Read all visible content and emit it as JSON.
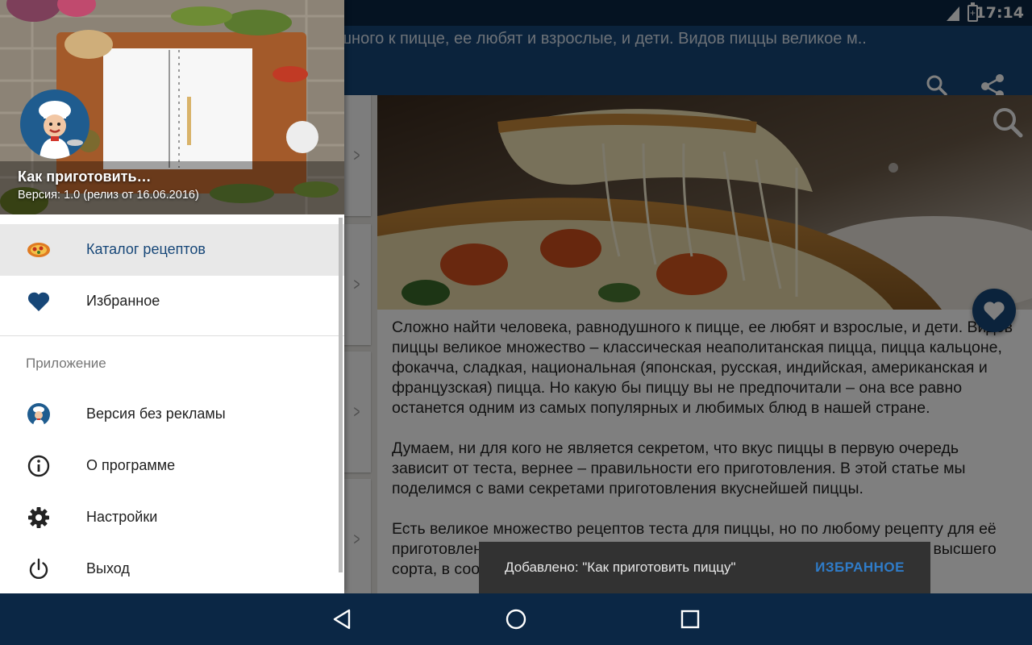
{
  "status_bar": {
    "time": "17:14",
    "battery_glyph": "+"
  },
  "toolbar": {
    "title": "…шного к пицце, ее любят и взрослые, и дети. Видов пиццы великое м..",
    "search_icon": "search-icon",
    "share_icon": "share-icon"
  },
  "article": {
    "paragraphs": [
      "Сложно найти человека, равнодушного к пицце, ее любят и взрослые, и дети. Видов пиццы великое множество – классическая неаполитанская пицца, пицца кальцоне, фокачча, сладкая, национальная (японская, русская, индийская, американская и французская) пицца. Но какую бы пиццу вы не предпочитали – она все равно останется одним из самых популярных и любимых блюд в нашей стране.",
      "Думаем, ни для кого не является секретом, что вкус пиццы в первую очередь зависит от теста, вернее – правильности его приготовления. В этой статье мы поделимся с вами секретами приготовления вкуснейшей пиццы.",
      "Есть великое множество рецептов теста для пиццы, но по любому рецепту для её приготовления используют в основном два вида муки – хлебопекарную и высшего сорта, в соотношении"
    ]
  },
  "snackbar": {
    "message": "Добавлено: \"Как приготовить пиццу\"",
    "action": "ИЗБРАННОЕ"
  },
  "drawer": {
    "app_name": "Как приготовить…",
    "version": "Версия: 1.0 (релиз от 16.06.2016)",
    "menu": [
      {
        "label": "Каталог рецептов",
        "icon": "pizza-icon",
        "active": true
      },
      {
        "label": "Избранное",
        "icon": "heart-icon",
        "active": false
      }
    ],
    "section_title": "Приложение",
    "app_menu": [
      {
        "label": "Версия без рекламы",
        "icon": "chef-icon"
      },
      {
        "label": "О программе",
        "icon": "info-icon"
      },
      {
        "label": "Настройки",
        "icon": "gear-icon"
      },
      {
        "label": "Выход",
        "icon": "power-icon"
      }
    ]
  },
  "nav_bar": {
    "buttons": [
      "back-icon",
      "home-icon",
      "recents-icon"
    ]
  },
  "colors": {
    "primary": "#174778",
    "status_bar": "#0b2745",
    "active_item_bg": "#e8e8e8",
    "snackbar_action": "#2f7cc9",
    "snackbar_bg": "#323232"
  }
}
